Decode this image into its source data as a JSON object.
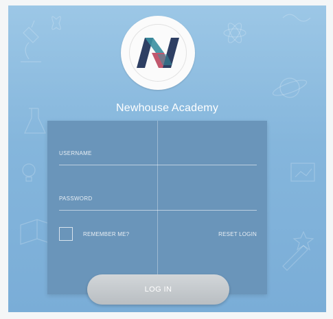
{
  "brand": {
    "name": "Newhouse Academy",
    "logo_icon": "newhouse-n-logo"
  },
  "form": {
    "username_label": "USERNAME",
    "username_value": "",
    "password_label": "PASSWORD",
    "password_value": "",
    "remember_label": "REMEMBER ME?",
    "remember_checked": false,
    "reset_label": "RESET LOGIN",
    "login_button": "LOG IN"
  },
  "colors": {
    "background": "#85b6dc",
    "card": "#6a95ba",
    "button": "#c6cbcf",
    "logo_teal": "#3a8fa0",
    "logo_red": "#b63b55",
    "logo_navy": "#2e3f63"
  }
}
